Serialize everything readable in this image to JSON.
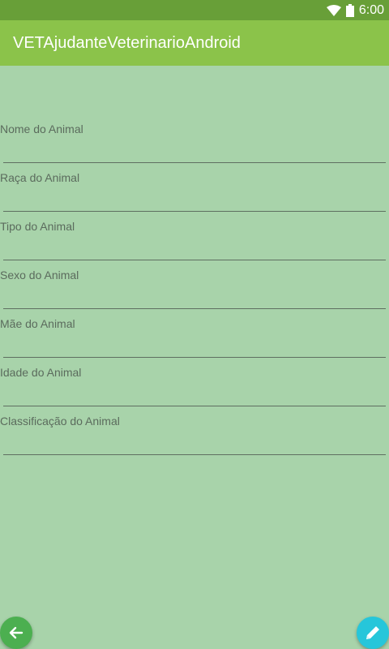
{
  "status_bar": {
    "time": "6:00",
    "wifi_icon": "wifi-icon",
    "battery_icon": "battery-icon"
  },
  "app_bar": {
    "title": "VETAjudanteVeterinarioAndroid"
  },
  "form": {
    "fields": [
      {
        "label": "Nome do Animal",
        "value": ""
      },
      {
        "label": "Raça do Animal",
        "value": ""
      },
      {
        "label": "Tipo do Animal",
        "value": ""
      },
      {
        "label": "Sexo do Animal",
        "value": ""
      },
      {
        "label": "Mãe do Animal",
        "value": ""
      },
      {
        "label": "Idade do Animal",
        "value": ""
      },
      {
        "label": "Classificação do Animal",
        "value": ""
      }
    ]
  },
  "actions": {
    "back_icon": "arrow-left-icon",
    "edit_icon": "pencil-icon"
  },
  "colors": {
    "status_bar": "#689f38",
    "app_bar": "#8bc34a",
    "background": "#a8d3aa",
    "fab_back": "#4caf50",
    "fab_edit": "#26c6da"
  }
}
